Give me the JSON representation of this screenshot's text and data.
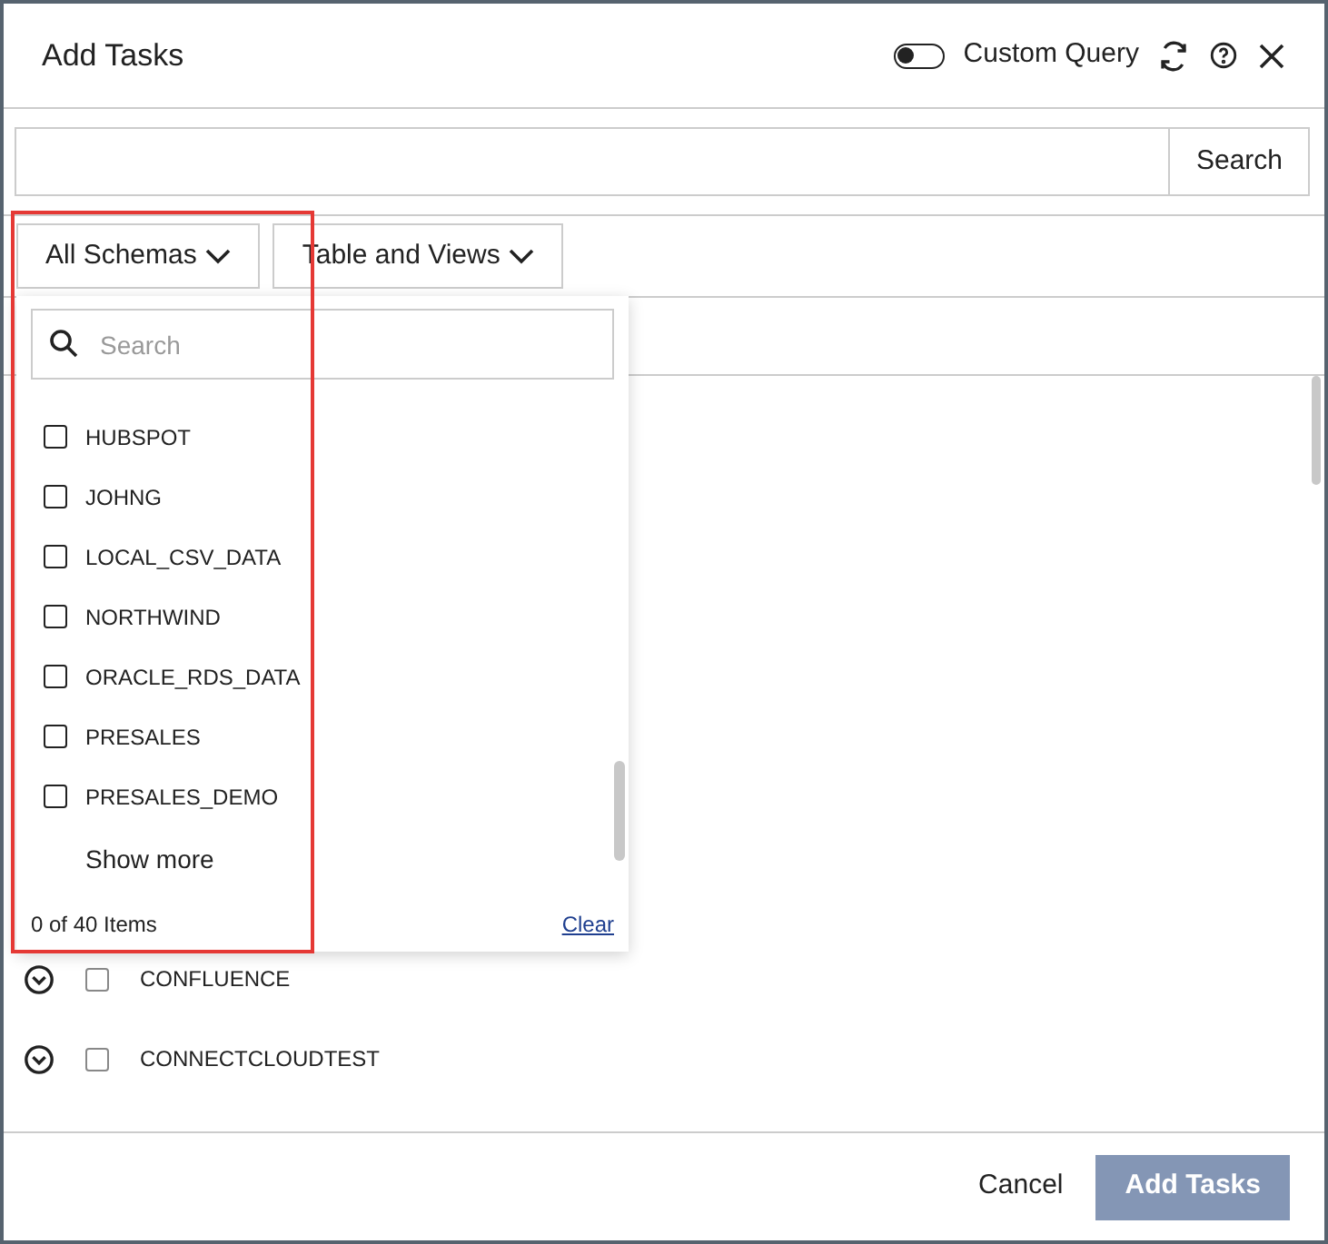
{
  "dialog": {
    "title": "Add Tasks",
    "custom_query": {
      "label": "Custom Query",
      "on": false
    }
  },
  "search_bar": {
    "button": "Search"
  },
  "filters": [
    {
      "label": "All Schemas"
    },
    {
      "label": "Table and Views"
    }
  ],
  "schema_list": [
    {
      "name": "CONFLUENCE",
      "checked": false
    },
    {
      "name": "CONNECTCLOUDTEST",
      "checked": false
    }
  ],
  "schema_dropdown": {
    "placeholder": "Search",
    "items": [
      {
        "name": "HUBSPOT",
        "checked": false
      },
      {
        "name": "JOHNG",
        "checked": false
      },
      {
        "name": "LOCAL_CSV_DATA",
        "checked": false
      },
      {
        "name": "NORTHWIND",
        "checked": false
      },
      {
        "name": "ORACLE_RDS_DATA",
        "checked": false
      },
      {
        "name": "PRESALES",
        "checked": false
      },
      {
        "name": "PRESALES_DEMO",
        "checked": false
      }
    ],
    "show_more": "Show more",
    "count": "0 of 40 Items",
    "clear": "Clear"
  },
  "footer": {
    "cancel": "Cancel",
    "submit": {
      "label": "Add Tasks",
      "disabled": true
    }
  }
}
